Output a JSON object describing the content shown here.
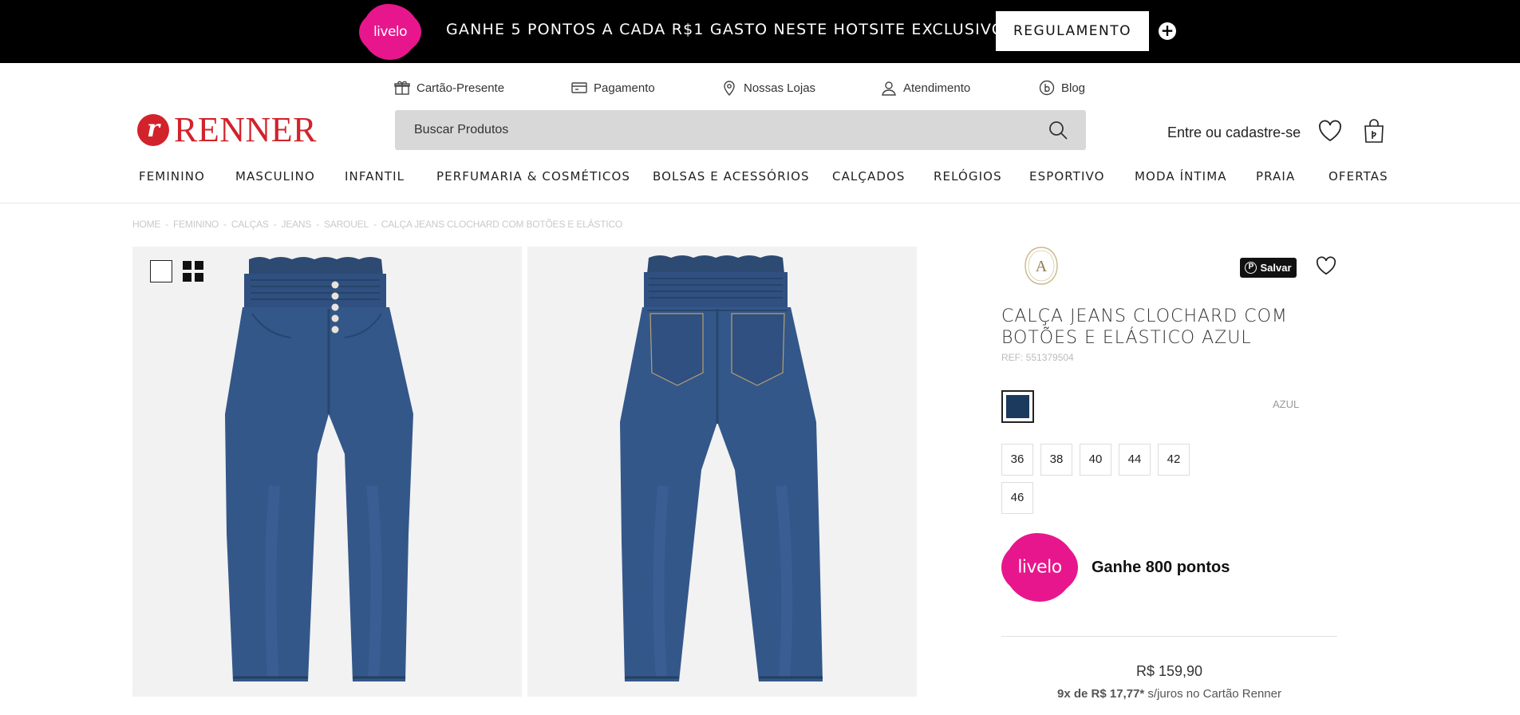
{
  "promo": {
    "livelo_logo": "livelo",
    "text": "GANHE 5 PONTOS A CADA R$1 GASTO NESTE HOTSITE EXCLUSIVO",
    "button": "REGULAMENTO",
    "plus_icon": "plus-circle-icon"
  },
  "utility_links": [
    {
      "label": "Cartão-Presente",
      "icon": "gift-icon"
    },
    {
      "label": "Pagamento",
      "icon": "card-icon"
    },
    {
      "label": "Nossas Lojas",
      "icon": "location-pin-icon"
    },
    {
      "label": "Atendimento",
      "icon": "user-icon"
    },
    {
      "label": "Blog",
      "icon": "blog-icon"
    }
  ],
  "header": {
    "logo_mark": "r",
    "logo_text": "RENNER",
    "search_placeholder": "Buscar Produtos",
    "login": "Entre ou cadastre-se"
  },
  "nav": [
    "FEMININO",
    "MASCULINO",
    "INFANTIL",
    "PERFUMARIA & COSMÉTICOS",
    "BOLSAS E ACESSÓRIOS",
    "CALÇADOS",
    "RELÓGIOS",
    "ESPORTIVO",
    "MODA ÍNTIMA",
    "PRAIA",
    "OFERTAS"
  ],
  "breadcrumb": [
    "HOME",
    "FEMININO",
    "CALÇAS",
    "JEANS",
    "SAROUEL",
    "CALÇA JEANS CLOCHARD COM BOTÕES E ELÁSTICO"
  ],
  "breadcrumb_sep": "-",
  "product": {
    "brand_monogram": "A",
    "pinterest": "Salvar",
    "title": "CALÇA JEANS CLOCHARD COM BOTÕES E ELÁSTICO AZUL",
    "ref": "REF: 551379504",
    "color_name": "AZUL",
    "swatch_color": "#1b3a5e",
    "sizes": [
      "36",
      "38",
      "40",
      "44",
      "42",
      "46"
    ],
    "livelo_logo": "livelo",
    "earn": "Ganhe 800 pontos",
    "price": "R$ 159,90",
    "installments_bold": "9x de R$ 17,77*",
    "installments_rest": "s/juros no Cartão Renner"
  },
  "colors": {
    "brand_red": "#d2222b",
    "livelo_pink": "#e8168c",
    "denim": "#2f4f7a"
  }
}
